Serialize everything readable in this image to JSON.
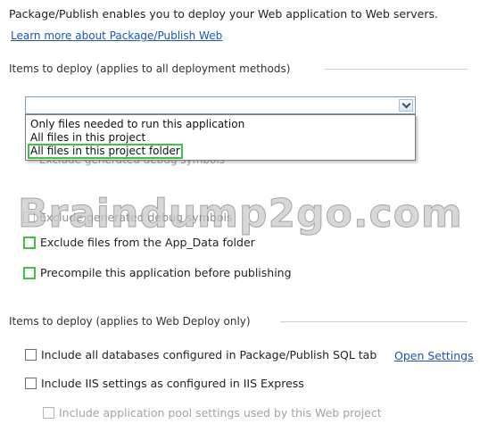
{
  "intro_text": "Package/Publish enables you to deploy your Web application to Web servers.",
  "learn_more_link": "Learn more about Package/Publish Web",
  "section1": {
    "header": "Items to deploy (applies to all deployment methods)",
    "combo_value": "",
    "options": [
      "Only files needed to run this application",
      "All files in this project",
      "All files in this project folder"
    ],
    "obscured_text": "Exclude generated debug symbols",
    "obscured_checkbox_label": "Exclude generated debug symbols",
    "checkboxes": [
      {
        "label": "Exclude files from the App_Data folder",
        "checked": false
      },
      {
        "label": "Precompile this application before publishing",
        "checked": false
      }
    ]
  },
  "watermark": "Braindump2go.com",
  "section2": {
    "header": "Items to deploy (applies to Web Deploy only)",
    "checkboxes": [
      {
        "label": "Include all databases configured in Package/Publish SQL tab",
        "checked": false
      },
      {
        "label": "Include IIS settings as configured in IIS Express",
        "checked": false
      },
      {
        "label": "Include application pool settings used by this Web project",
        "checked": false,
        "disabled": true
      }
    ],
    "open_settings_link": "Open Settings"
  },
  "colors": {
    "link": "#1a56b4",
    "highlight": "#3fc43f",
    "combo_border": "#7a9cc4"
  }
}
